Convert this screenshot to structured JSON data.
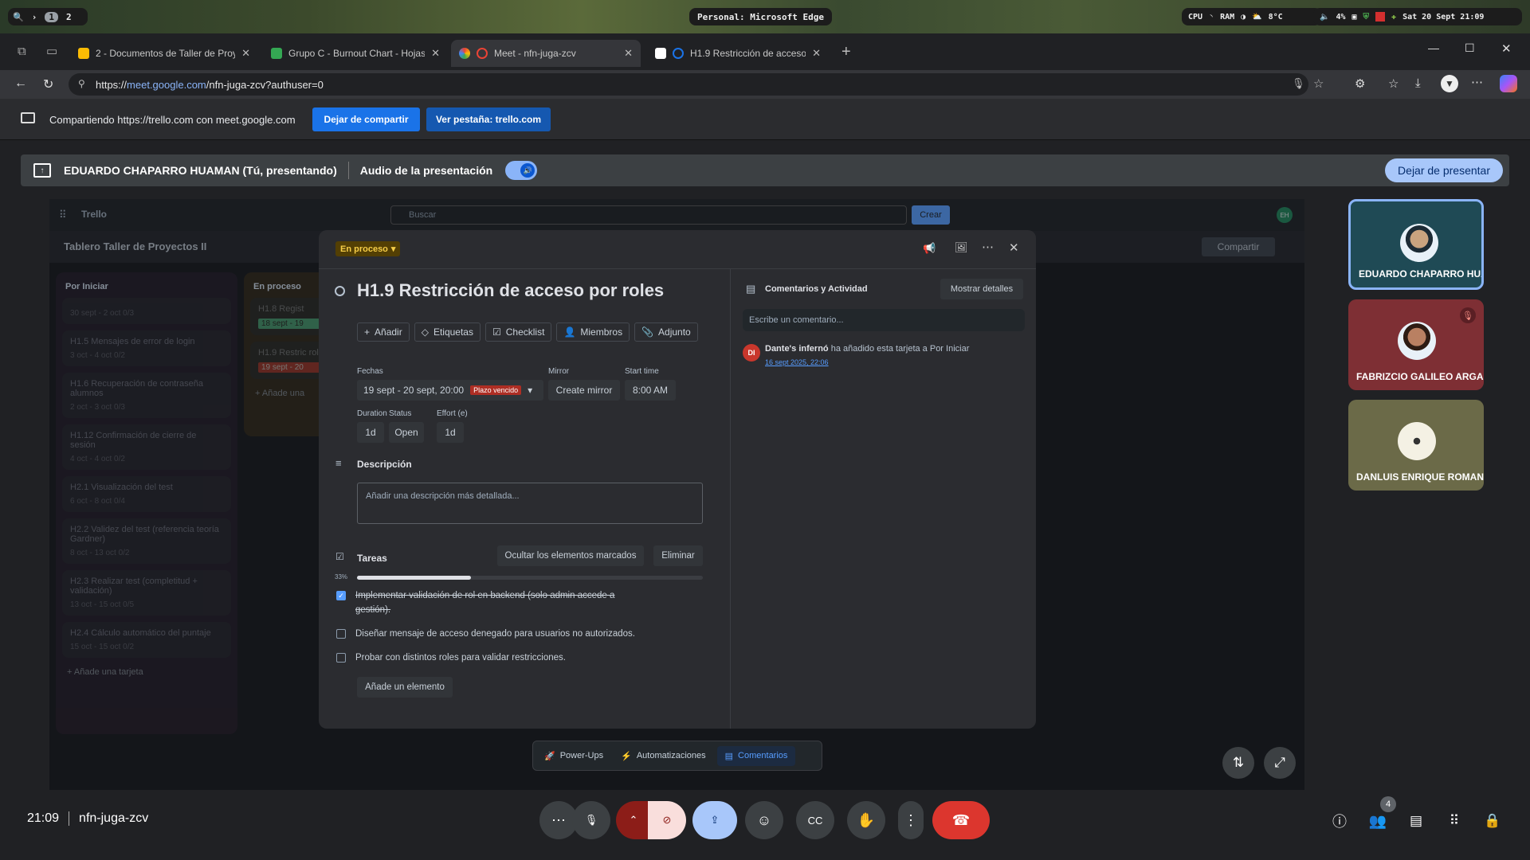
{
  "system_bar": {
    "workspaces": [
      "1",
      "2"
    ],
    "window_title": "Personal: Microsoft Edge",
    "cpu_label": "CPU",
    "ram_label": "RAM",
    "temperature": "8°C",
    "volume": "4%",
    "datetime": "Sat 20 Sept 21:09"
  },
  "browser": {
    "tabs": [
      {
        "label": "2 - Documentos de Taller de Proy",
        "color": "#fbbc04"
      },
      {
        "label": "Grupo C - Burnout Chart - Hojas",
        "color": "#34a853"
      },
      {
        "label": "Meet - nfn-juga-zcv",
        "color": "#ea4335"
      },
      {
        "label": "H1.9 Restricción de acceso p",
        "color": "#1a73e8"
      }
    ],
    "url_prefix": "https://",
    "url_host": "meet.google.com",
    "url_path": "/nfn-juga-zcv?authuser=0"
  },
  "share_bar": {
    "message": "Compartiendo https://trello.com con meet.google.com",
    "stop_button": "Dejar de compartir",
    "view_tab_button": "Ver pestaña: trello.com"
  },
  "presenting_bar": {
    "presenter": "EDUARDO CHAPARRO HUAMAN (Tú, presentando)",
    "audio_label": "Audio de la presentación",
    "stop_presenting": "Dejar de presentar"
  },
  "trello": {
    "logo": "Trello",
    "search_placeholder": "Buscar",
    "create_button": "Crear",
    "board_title": "Tablero Taller de Proyectos II",
    "share_button": "Compartir",
    "avatar_initials": "EH",
    "lists": [
      {
        "title": "Por Iniciar",
        "cards": [
          {
            "title": "",
            "meta": "30 sept - 2 oct   0/3"
          },
          {
            "title": "H1.5 Mensajes de error de login",
            "meta": "3 oct - 4 oct   0/2"
          },
          {
            "title": "H1.6 Recuperación de contraseña alumnos",
            "meta": "2 oct - 3 oct   0/3"
          },
          {
            "title": "H1.12 Confirmación de cierre de sesión",
            "meta": "4 oct - 4 oct   0/2"
          },
          {
            "title": "H2.1 Visualización del test",
            "meta": "6 oct - 8 oct   0/4"
          },
          {
            "title": "H2.2 Validez del test (referencia teoría Gardner)",
            "meta": "8 oct - 13 oct   0/2"
          },
          {
            "title": "H2.3 Realizar test (completitud + validación)",
            "meta": "13 oct - 15 oct   0/5"
          },
          {
            "title": "H2.4 Cálculo automático del puntaje",
            "meta": "15 oct - 15 oct   0/2"
          }
        ],
        "add_card": "Añade una tarjeta"
      },
      {
        "title": "En proceso",
        "cards": [
          {
            "title": "H1.8 Regist",
            "meta": "18 sept - 19"
          },
          {
            "title": "H1.9 Restric roles",
            "meta": "19 sept - 20"
          }
        ],
        "add_card": "Añade una"
      }
    ]
  },
  "card_modal": {
    "status": "En proceso",
    "title": "H1.9 Restricción de acceso por roles",
    "actions": [
      "Añadir",
      "Etiquetas",
      "Checklist",
      "Miembros",
      "Adjunto"
    ],
    "dates_label": "Fechas",
    "dates_value": "19 sept - 20 sept, 20:00",
    "overdue_badge": "Plazo vencido",
    "mirror_label": "Mirror",
    "mirror_button": "Create mirror",
    "start_time_label": "Start time",
    "start_time_value": "8:00 AM",
    "duration_label": "Duration",
    "duration_value": "1d",
    "status_label": "Status",
    "status_value": "Open",
    "effort_label": "Effort (e)",
    "effort_value": "1d",
    "description_heading": "Descripción",
    "description_placeholder": "Añadir una descripción más detallada...",
    "tasks_heading": "Tareas",
    "hide_checked_button": "Ocultar los elementos marcados",
    "delete_button": "Eliminar",
    "progress_label": "33%",
    "progress": 0.33,
    "tasks": [
      {
        "text": "Implementar validación de rol en backend (solo admin accede a gestión).",
        "done": true
      },
      {
        "text": "Diseñar mensaje de acceso denegado para usuarios no autorizados.",
        "done": false
      },
      {
        "text": "Probar con distintos roles para validar restricciones.",
        "done": false
      }
    ],
    "add_item_button": "Añade un elemento",
    "comments_heading": "Comentarios y Actividad",
    "show_details_button": "Mostrar detalles",
    "comment_placeholder": "Escribe un comentario...",
    "activity": {
      "initials": "DI",
      "author": "Dante's infernó",
      "text": "ha añadido esta tarjeta a Por Iniciar",
      "timestamp": "16 sept 2025, 22:06"
    }
  },
  "trello_footer": {
    "powerups": "Power-Ups",
    "automations": "Automatizaciones",
    "comments": "Comentarios"
  },
  "participants": [
    {
      "name": "EDUARDO CHAPARRO HUA...",
      "muted": false,
      "bg": "#1f4a55"
    },
    {
      "name": "FABRIZCIO GALILEO ARGAN...",
      "muted": true,
      "bg": "#7e2f34"
    },
    {
      "name": "DANLUIS ENRIQUE ROMANI ...",
      "muted": false,
      "bg": "#6b6a48"
    }
  ],
  "meet_bottom": {
    "time": "21:09",
    "meeting_code": "nfn-juga-zcv",
    "participant_count": "4"
  }
}
